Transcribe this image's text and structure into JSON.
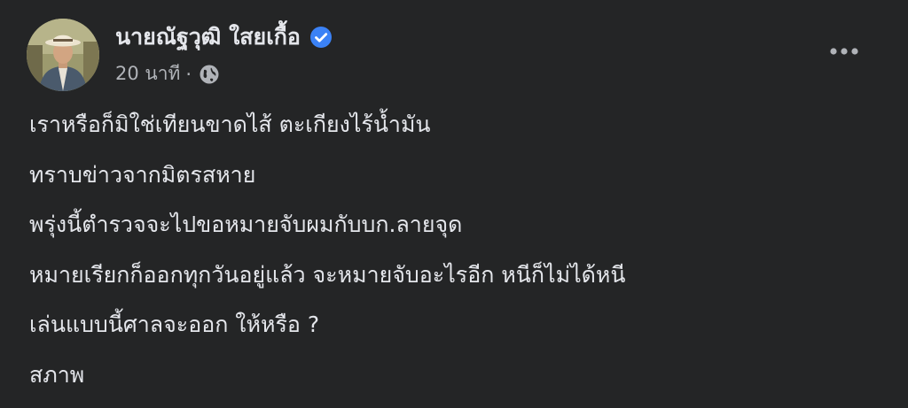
{
  "post": {
    "author_name": "นายณัฐวุฒิ ใสยเกื้อ",
    "time": "20 นาที",
    "separator": "·",
    "privacy_icon": "globe-icon",
    "verified_icon": "verified-badge-icon",
    "more_icon": "more-options-icon",
    "lines": [
      "เราหรือก็มิใช่เทียนขาดไส้ ตะเกียงไร้น้ำมัน",
      "ทราบข่าวจากมิตรสหาย",
      "พรุ่งนี้ตำรวจจะไปขอหมายจับผมกับบก.ลายจุด",
      "หมายเรียกก็ออกทุกวันอยู่แล้ว จะหมายจับอะไรอีก หนีก็ไม่ได้หนี",
      "เล่นแบบนี้ศาลจะออก ให้หรือ ?",
      "สภาพ"
    ]
  },
  "colors": {
    "background": "#242526",
    "primary_text": "#e4e6eb",
    "secondary_text": "#b0b3b8",
    "verified_blue": "#3b82f6"
  }
}
